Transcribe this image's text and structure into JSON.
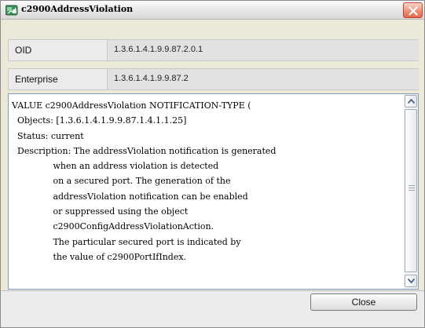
{
  "window": {
    "title": "c2900AddressViolation"
  },
  "fields": {
    "oid_label": "OID",
    "oid_value": "1.3.6.1.4.1.9.9.87.2.0.1",
    "enterprise_label": "Enterprise",
    "enterprise_value": "1.3.6.1.4.1.9.9.87.2"
  },
  "definition": {
    "lines": [
      "VALUE c2900AddressViolation NOTIFICATION-TYPE (",
      "  Objects: [1.3.6.1.4.1.9.9.87.1.4.1.1.25]",
      "  Status: current",
      "  Description: The addressViolation notification is generated",
      "               when an address violation is detected",
      "               on a secured port. The generation of the",
      "               addressViolation notification can be enabled",
      "               or suppressed using the object",
      "               c2900ConfigAddressViolationAction.",
      "               The particular secured port is indicated by",
      "               the value of c2900PortIfIndex."
    ]
  },
  "footer": {
    "close_label": "Close"
  },
  "colors": {
    "close_x_accent": "#e06a4c",
    "panel_border": "#7f9db9"
  },
  "icons": [
    "app-icon",
    "close-icon",
    "scroll-up-icon",
    "scroll-down-icon"
  ]
}
